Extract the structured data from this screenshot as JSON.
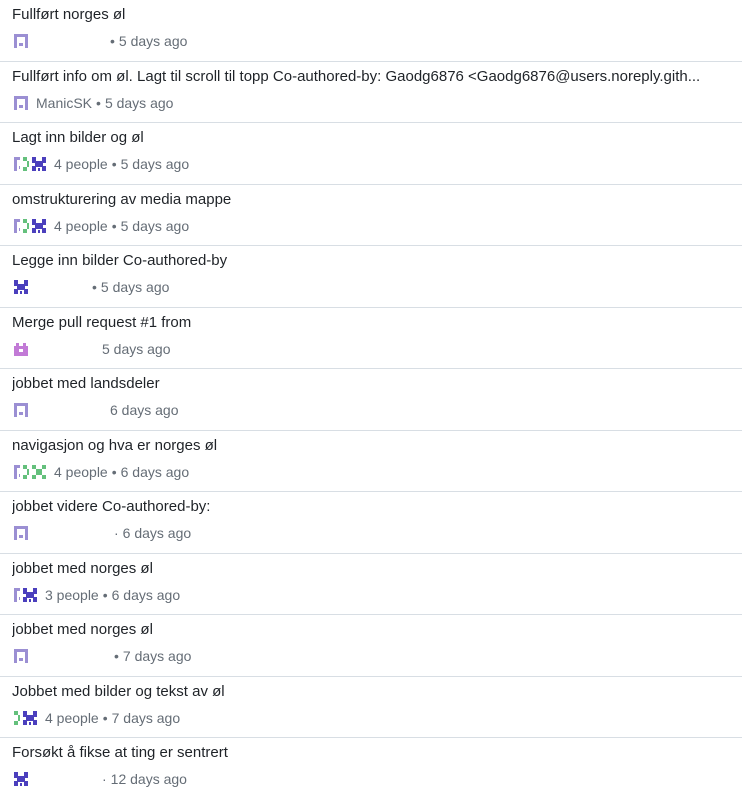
{
  "colors": {
    "violet": "#9b8fd3",
    "lavender": "#c6b6ef",
    "navy": "#4b3fbd",
    "green": "#64c07c",
    "pink": "#c27ad6"
  },
  "commits": [
    {
      "title": "Fullført norges øl",
      "author": "",
      "avatars": [
        "lavender"
      ],
      "time": "5 days ago",
      "separator": "•"
    },
    {
      "title": "Fullført info om øl. Lagt til scroll til topp Co-authored-by: Gaodg6876 <Gaodg6876@users.noreply.gith...",
      "author": "ManicSK",
      "avatars": [
        "lavender"
      ],
      "time": "5 days ago",
      "separator": "•"
    },
    {
      "title": "Lagt inn bilder og øl",
      "author": "4 people",
      "avatars": [
        "lavender",
        "green",
        "navy"
      ],
      "time": "5 days ago",
      "separator": "•"
    },
    {
      "title": "omstrukturering av media mappe",
      "author": "4 people",
      "avatars": [
        "lavender",
        "green",
        "navy"
      ],
      "time": "5 days ago",
      "separator": "•"
    },
    {
      "title": "Legge inn bilder Co-authored-by",
      "author": "",
      "avatars": [
        "navy"
      ],
      "time": "5 days ago",
      "separator": "•"
    },
    {
      "title": "Merge pull request #1 from",
      "author": "",
      "avatars": [
        "pink"
      ],
      "time": "5 days ago",
      "separator": ""
    },
    {
      "title": "jobbet med landsdeler",
      "author": "",
      "avatars": [
        "lavender"
      ],
      "time": "6 days ago",
      "separator": ""
    },
    {
      "title": "navigasjon og hva er norges øl",
      "author": "4 people",
      "avatars": [
        "lavender",
        "green",
        "green"
      ],
      "time": "6 days ago",
      "separator": "•"
    },
    {
      "title": "jobbet videre Co-authored-by:",
      "author": "",
      "avatars": [
        "lavender"
      ],
      "time": "6 days ago",
      "separator": "·"
    },
    {
      "title": "jobbet med norges øl",
      "author": "3 people",
      "avatars": [
        "lavender",
        "navy"
      ],
      "time": "6 days ago",
      "separator": "•"
    },
    {
      "title": "jobbet med norges øl",
      "author": "",
      "avatars": [
        "lavender"
      ],
      "time": "7 days ago",
      "separator": "•"
    },
    {
      "title": "Jobbet med bilder og tekst av øl",
      "author": "4 people",
      "avatars": [
        "green",
        "navy"
      ],
      "time": "7 days ago",
      "separator": "•"
    },
    {
      "title": "Forsøkt å fikse at ting er sentrert",
      "author": "",
      "avatars": [
        "navy"
      ],
      "time": "12 days ago",
      "separator": "·"
    }
  ]
}
